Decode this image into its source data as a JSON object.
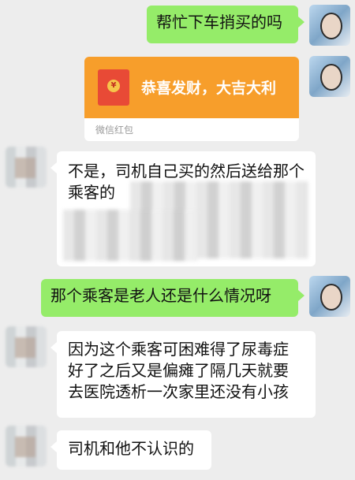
{
  "messages": [
    {
      "side": "me",
      "text": "帮忙下车捎买的吗"
    },
    {
      "side": "me",
      "type": "red_packet",
      "title": "恭喜发财，大吉大利",
      "source": "微信红包",
      "seal": "¥"
    },
    {
      "side": "other",
      "text": "不是，司机自己买的然后送给那个乘客的"
    },
    {
      "side": "me",
      "text": "那个乘客是老人还是什么情况呀"
    },
    {
      "side": "other",
      "lines": [
        "因为这个乘客可困难得了尿毒症",
        "好了之后又是偏瘫了隔几天就要",
        "去医院透析一次家里还没有小孩"
      ]
    },
    {
      "side": "other",
      "text": "司机和他不认识的"
    }
  ]
}
